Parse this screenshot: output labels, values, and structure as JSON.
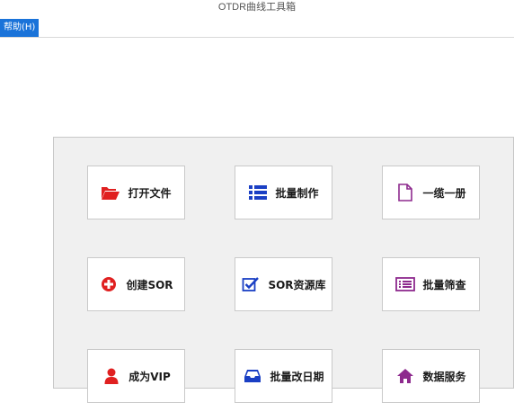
{
  "window": {
    "title": "OTDR曲线工具箱"
  },
  "menubar": {
    "items": [
      {
        "label": "帮助(H)"
      }
    ]
  },
  "tiles": [
    {
      "label": "打开文件",
      "icon": "folder-open-icon",
      "color": "#e02020"
    },
    {
      "label": "批量制作",
      "icon": "list-icon",
      "color": "#1a3fc4"
    },
    {
      "label": "一缆一册",
      "icon": "document-icon",
      "color": "#8e2a8e"
    },
    {
      "label": "创建SOR",
      "icon": "plus-circle-icon",
      "color": "#e02020"
    },
    {
      "label": "SOR资源库",
      "icon": "check-square-icon",
      "color": "#1a3fc4"
    },
    {
      "label": "批量筛查",
      "icon": "list-box-icon",
      "color": "#8e2a8e"
    },
    {
      "label": "成为VIP",
      "icon": "user-icon",
      "color": "#e02020"
    },
    {
      "label": "批量改日期",
      "icon": "inbox-icon",
      "color": "#1a3fc4"
    },
    {
      "label": "数据服务",
      "icon": "home-icon",
      "color": "#8e2a8e"
    }
  ]
}
